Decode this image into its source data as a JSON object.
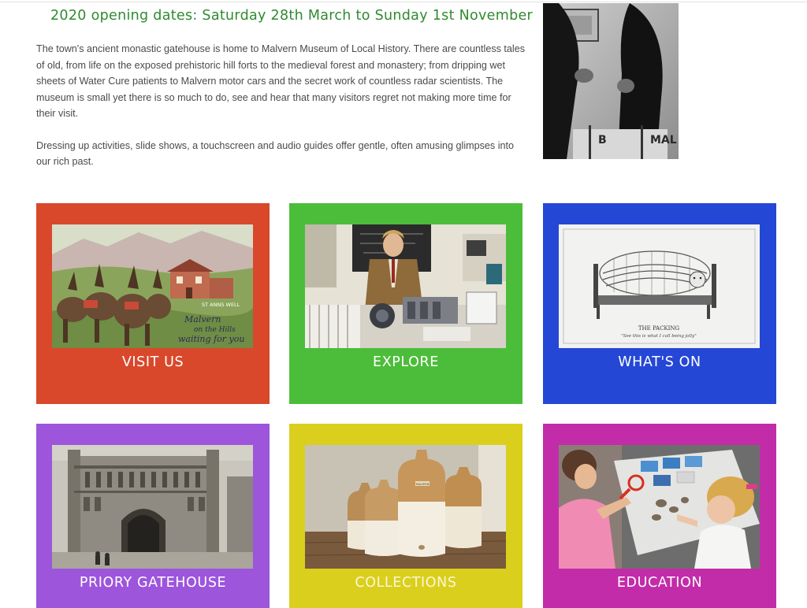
{
  "opening": {
    "headline": "2020 opening dates:  Saturday 28th March to Sunday 1st November"
  },
  "intro": {
    "paragraph_1": "The town's ancient monastic gatehouse is home to Malvern Museum of Local History.  There are countless tales of old, from life on the exposed prehistoric hill forts to the medieval forest and monastery; from dripping wet sheets of Water Cure patients to Malvern motor cars and the secret work of countless radar scientists. The museum is small yet there is so much to do, see and hear that many visitors regret not making more time for their visit.",
    "paragraph_2": "Dressing up activities, slide shows, a touchscreen and audio guides offer gentle, often amusing glimpses into our rich past."
  },
  "hero": {
    "sign_text": "MAL",
    "sign_letter": "B"
  },
  "tiles": [
    {
      "label": "VISIT US",
      "color": "#d9482b",
      "postcard_sign": "ST ANNS WELL",
      "postcard_script": [
        "Malvern",
        "on the Hills",
        "waiting for you"
      ]
    },
    {
      "label": "EXPLORE",
      "color": "#4cbd3a"
    },
    {
      "label": "WHAT'S ON",
      "color": "#2547d6",
      "cartoon_title": "THE PACKING",
      "cartoon_caption": "\"See this is what I call being jolly\""
    },
    {
      "label": "PRIORY GATEHOUSE",
      "color": "#9d55dc"
    },
    {
      "label": "COLLECTIONS",
      "color": "#dacf1c",
      "jar_label": "MALVERN"
    },
    {
      "label": "EDUCATION",
      "color": "#c22ca9"
    }
  ]
}
